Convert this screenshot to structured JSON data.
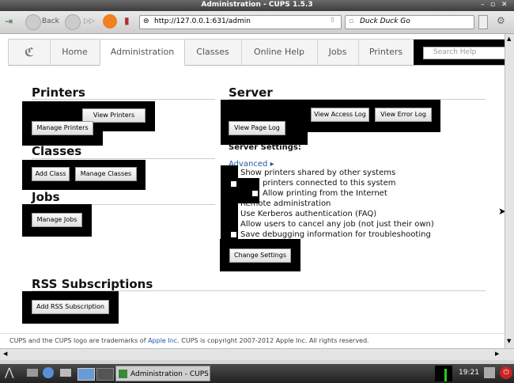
{
  "window": {
    "title": "Administration - CUPS 1.5.3"
  },
  "browser": {
    "back_label": "Back",
    "url": "http://127.0.0.1:631/admin",
    "search_placeholder": "Duck Duck Go"
  },
  "tabs": [
    "Home",
    "Administration",
    "Classes",
    "Online Help",
    "Jobs",
    "Printers"
  ],
  "help_search_placeholder": "Search Help",
  "sections": {
    "printers": {
      "title": "Printers",
      "buttons": [
        "View Printers",
        "Manage Printers"
      ]
    },
    "classes": {
      "title": "Classes",
      "buttons": [
        "Add Class",
        "Manage Classes"
      ]
    },
    "jobs": {
      "title": "Jobs",
      "buttons": [
        "Manage Jobs"
      ]
    },
    "server": {
      "title": "Server",
      "buttons": [
        "View Access Log",
        "View Error Log",
        "View Page Log"
      ]
    },
    "rss": {
      "title": "RSS Subscriptions",
      "buttons": [
        "Add RSS Subscription"
      ]
    }
  },
  "server_settings": {
    "heading": "Server Settings:",
    "advanced_link": "Advanced ▸",
    "options": [
      "Show printers shared by other systems",
      "printers connected to this system",
      "Allow printing from the Internet",
      "Remote administration",
      "Use Kerberos authentication (FAQ)",
      "Allow users to cancel any job (not just their own)",
      "Save debugging information for troubleshooting"
    ],
    "faq_link": "FAQ",
    "change_button": "Change Settings"
  },
  "footer": {
    "text_before": "CUPS and the CUPS logo are trademarks of ",
    "apple_link": "Apple Inc.",
    "text_after": " CUPS is copyright 2007-2012 Apple Inc. All rights reserved."
  },
  "taskbar": {
    "window_label": "Administration - CUPS ...",
    "clock": "19:21"
  },
  "colors": {
    "link": "#2255aa",
    "accent": "#000000"
  }
}
